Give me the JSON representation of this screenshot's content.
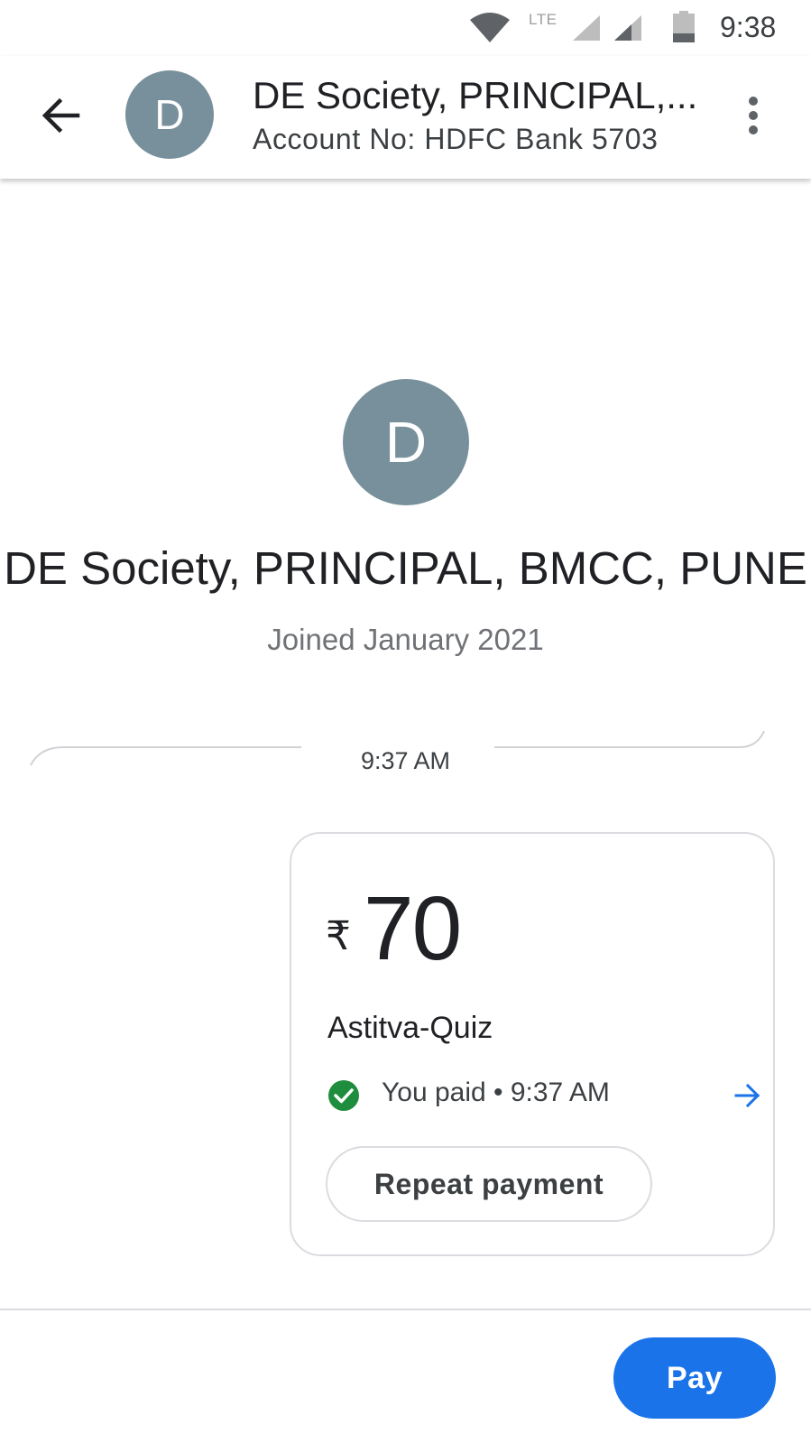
{
  "status_bar": {
    "network_label": "LTE",
    "time": "9:38",
    "icons": [
      "wifi-icon",
      "signal-icon",
      "signal-icon",
      "battery-icon"
    ]
  },
  "app_bar": {
    "avatar_letter": "D",
    "title": "DE Society, PRINCIPAL,...",
    "subtitle": "Account No: HDFC Bank 5703",
    "icons": [
      "back-arrow-icon",
      "more-vert-icon"
    ]
  },
  "contact": {
    "avatar_letter": "D",
    "name": "DE Society, PRINCIPAL, BMCC, PUNE",
    "joined": "Joined January 2021"
  },
  "timeline": {
    "time": "9:37 AM"
  },
  "payment_card": {
    "currency_symbol": "₹",
    "amount": "70",
    "note": "Astitva-Quiz",
    "status": "You paid • 9:37 AM",
    "status_color": "#1e8e3e",
    "repeat_label": "Repeat payment",
    "icons": [
      "check-circle-icon",
      "arrow-right-icon"
    ]
  },
  "footer": {
    "pay_label": "Pay",
    "accent_color": "#1a73e8"
  }
}
